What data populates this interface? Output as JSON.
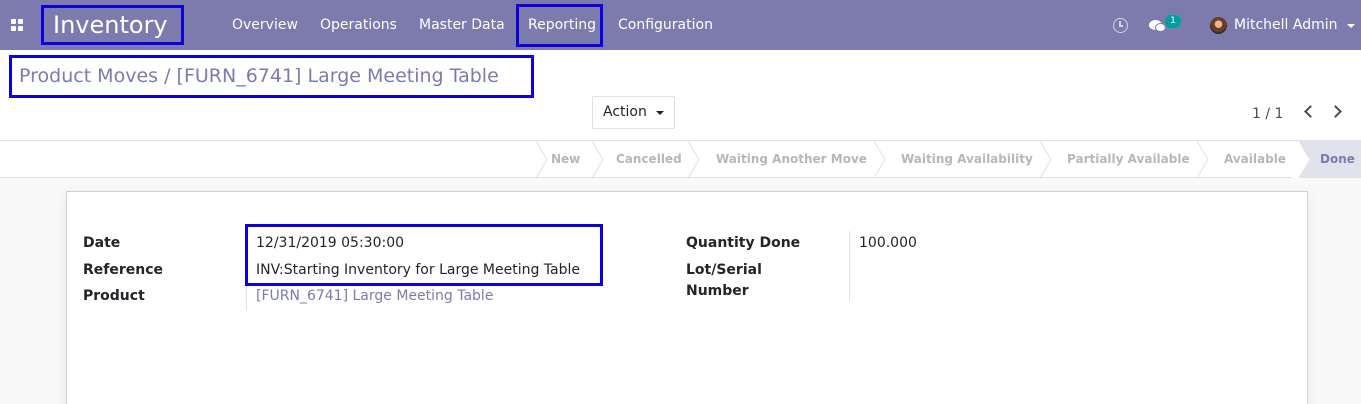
{
  "app": {
    "name": "Inventory"
  },
  "nav": {
    "menus": [
      "Overview",
      "Operations",
      "Master Data",
      "Reporting",
      "Configuration"
    ],
    "messages_count": "1",
    "user_name": "Mitchell Admin"
  },
  "breadcrumb": {
    "parent": "Product Moves",
    "separator": "/",
    "current": "[FURN_6741] Large Meeting Table"
  },
  "toolbar": {
    "action_label": "Action",
    "pager": "1 / 1"
  },
  "statusbar": {
    "steps": [
      "New",
      "Cancelled",
      "Waiting Another Move",
      "Waiting Availability",
      "Partially Available",
      "Available",
      "Done"
    ],
    "current_step": "Done"
  },
  "form": {
    "date_label": "Date",
    "date_value": "12/31/2019 05:30:00",
    "reference_label": "Reference",
    "reference_value": "INV:Starting Inventory for Large Meeting Table",
    "product_label": "Product",
    "product_value": "[FURN_6741] Large Meeting Table",
    "qty_done_label": "Quantity Done",
    "qty_done_value": "100.000",
    "lot_label_line1": "Lot/Serial",
    "lot_label_line2": "Number"
  },
  "colors": {
    "navbar": "#7c7bad",
    "highlight_box": "#0d00e0",
    "badge": "#00a09d",
    "link": "#7c7bad"
  }
}
